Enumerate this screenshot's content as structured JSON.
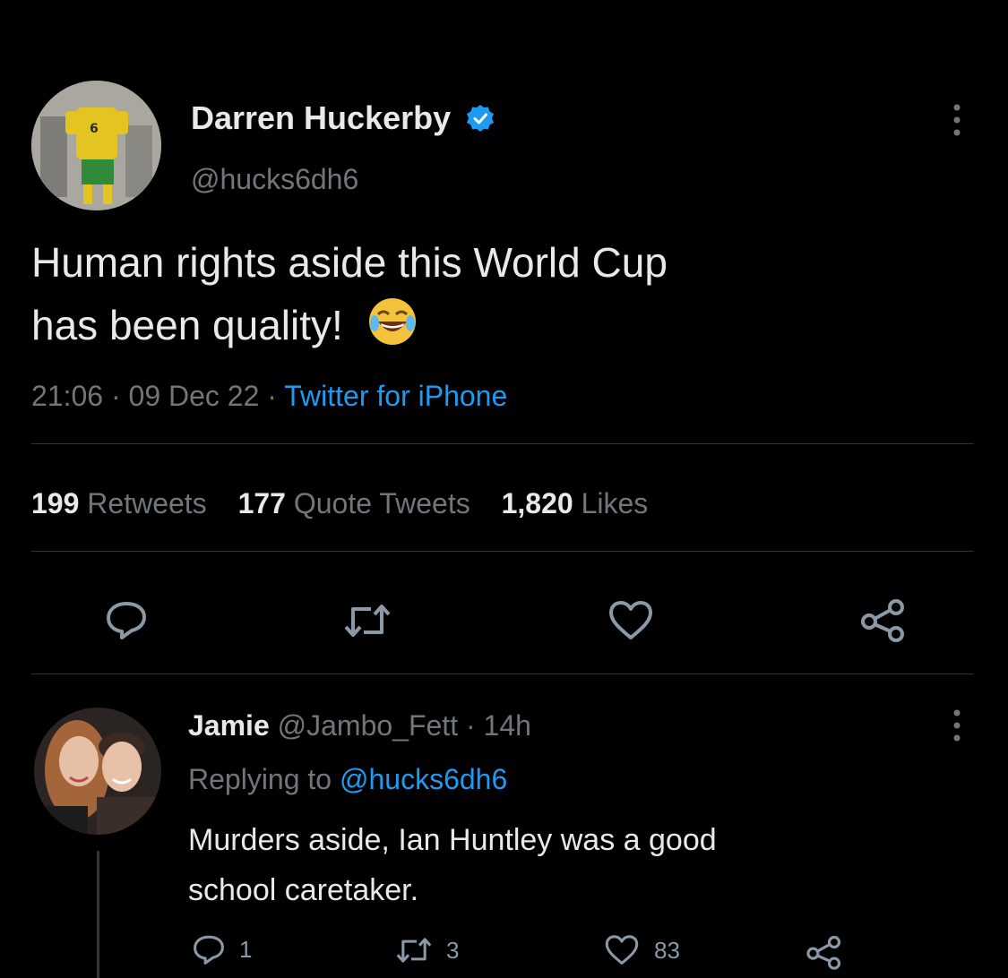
{
  "main_tweet": {
    "author_name": "Darren Huckerby",
    "author_handle": "@hucks6dh6",
    "avatar_label": "6",
    "text_line1": "Human rights aside this World Cup",
    "text_line2": "has been quality!",
    "emoji": "😂",
    "timestamp": "21:06 · 09 Dec 22 · ",
    "source": "Twitter for iPhone",
    "stats": {
      "retweets_count": "199",
      "retweets_label": "Retweets",
      "quotes_count": "177",
      "quotes_label": "Quote Tweets",
      "likes_count": "1,820",
      "likes_label": "Likes"
    }
  },
  "reply": {
    "author_name": "Jamie",
    "author_handle": "@Jambo_Fett",
    "time": " · 14h",
    "replying_to_label": "Replying to ",
    "replying_to_handle": "@hucks6dh6",
    "text_line1": "Murders aside, Ian Huntley was a good",
    "text_line2": "school caretaker.",
    "reply_count": "1",
    "retweet_count": "3",
    "like_count": "83"
  },
  "colors": {
    "background": "#000000",
    "text": "#e7e9ea",
    "muted": "#71767b",
    "accent": "#1d9bf0",
    "verified": "#1d9bf0"
  },
  "icons": [
    "more-icon",
    "verified-badge-icon",
    "reply-icon",
    "retweet-icon",
    "like-icon",
    "share-icon",
    "laughing-emoji"
  ]
}
